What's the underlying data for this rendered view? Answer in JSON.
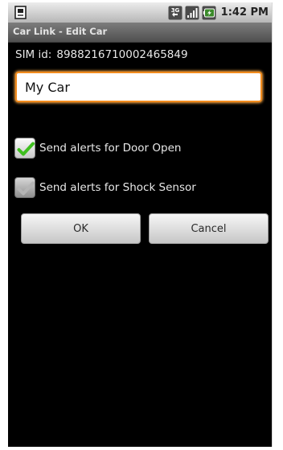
{
  "status_bar": {
    "time": "1:42 PM",
    "network_badge": "3G",
    "icons": [
      "notification-icon",
      "network-3g-icon",
      "signal-bars-icon",
      "battery-charging-icon"
    ]
  },
  "title_bar": {
    "title": "Car Link - Edit Car"
  },
  "sim": {
    "label": "SIM id:",
    "value": "8988216710002465849"
  },
  "name_field": {
    "value": "My Car"
  },
  "checkboxes": [
    {
      "label": "Send alerts for Door Open",
      "checked": true
    },
    {
      "label": "Send alerts for Shock Sensor",
      "checked": false
    }
  ],
  "buttons": {
    "ok_label": "OK",
    "cancel_label": "Cancel"
  },
  "colors": {
    "focus_orange": "#f28c1e",
    "check_green": "#3fbf1f",
    "background": "#000000",
    "status_bar": "#c8c8c8"
  }
}
